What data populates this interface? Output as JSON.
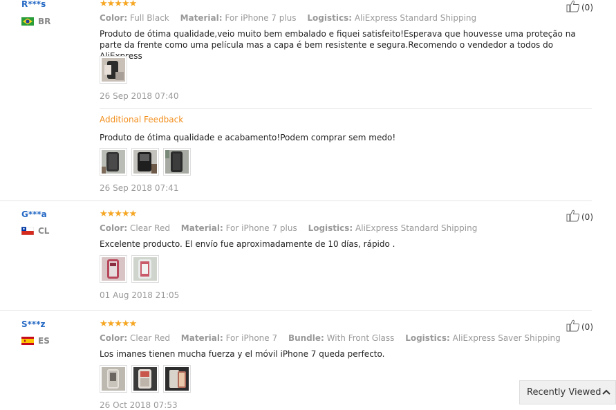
{
  "reviews": [
    {
      "user": "R***s",
      "country": "BR",
      "stars": "★★★★★",
      "props": [
        {
          "label": "Color:",
          "value": "Full Black"
        },
        {
          "label": "Material:",
          "value": "For iPhone 7 plus"
        },
        {
          "label": "Logistics:",
          "value": "AliExpress Standard Shipping"
        }
      ],
      "text": "Produto de ótima qualidade,veio muito bem embalado e fiquei satisfeito!Esperava que houvesse uma proteção na parte da frente como uma película mas a capa é bem resistente e segura.Recomendo o vendedor a todos do AliExpress",
      "date": "26 Sep 2018 07:40",
      "helpful": "(0)",
      "additional_label": "Additional Feedback",
      "additional_text": "Produto de ótima qualidade e acabamento!Podem comprar sem medo!",
      "additional_date": "26 Sep 2018 07:41"
    },
    {
      "user": "G***a",
      "country": "CL",
      "stars": "★★★★★",
      "props": [
        {
          "label": "Color:",
          "value": "Clear Red"
        },
        {
          "label": "Material:",
          "value": "For iPhone 7 plus"
        },
        {
          "label": "Logistics:",
          "value": "AliExpress Standard Shipping"
        }
      ],
      "text": "Excelente producto. El envío fue aproximadamente de 10 días, rápido .",
      "date": "01 Aug 2018 21:05",
      "helpful": "(0)"
    },
    {
      "user": "S***z",
      "country": "ES",
      "stars": "★★★★★",
      "props": [
        {
          "label": "Color:",
          "value": "Clear Red"
        },
        {
          "label": "Material:",
          "value": "For iPhone 7"
        },
        {
          "label": "Bundle:",
          "value": "With Front Glass"
        },
        {
          "label": "Logistics:",
          "value": "AliExpress Saver Shipping"
        }
      ],
      "text": "Los imanes tienen mucha fuerza y el móvil iPhone 7 queda perfecto.",
      "date": "26 Oct 2018 07:53",
      "helpful": "(0)"
    }
  ],
  "recently_viewed": "Recently Viewed"
}
